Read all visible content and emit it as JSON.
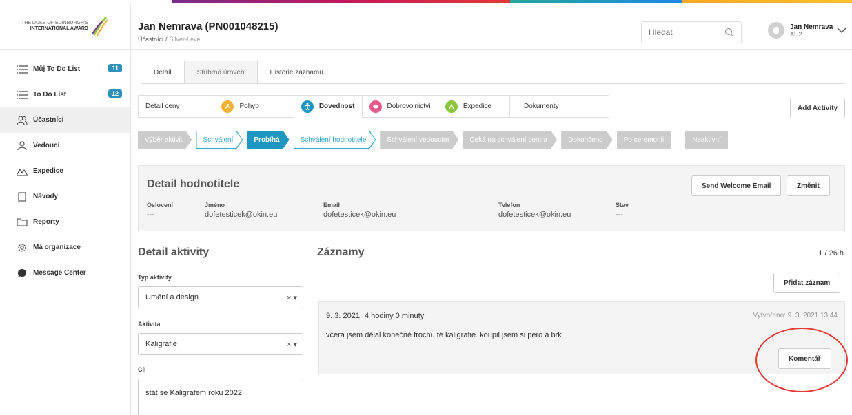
{
  "logo": {
    "line1": "THE DUKE OF EDINBURGH'S",
    "line2": "INTERNATIONAL AWARD"
  },
  "header": {
    "title": "Jan Nemrava (PN001048215)",
    "breadcrumb": [
      "Účastníci",
      "Silver-Level"
    ],
    "breadcrumb_sep": "/",
    "search_placeholder": "Hledat",
    "user_name": "Jan Nemrava",
    "user_role": "AU2"
  },
  "sidebar": {
    "items": [
      {
        "label": "Můj To Do List",
        "badge": "11",
        "icon": "list-icon"
      },
      {
        "label": "To Do List",
        "badge": "12",
        "icon": "list-icon"
      },
      {
        "label": "Účastníci",
        "badge": "",
        "icon": "participants-icon"
      },
      {
        "label": "Vedoucí",
        "badge": "",
        "icon": "leader-icon"
      },
      {
        "label": "Expedice",
        "badge": "",
        "icon": "mountain-icon"
      },
      {
        "label": "Návody",
        "badge": "",
        "icon": "book-icon"
      },
      {
        "label": "Reporty",
        "badge": "",
        "icon": "folder-icon"
      },
      {
        "label": "Má organizace",
        "badge": "",
        "icon": "gear-icon"
      },
      {
        "label": "Message Center",
        "badge": "",
        "icon": "chat-icon"
      }
    ]
  },
  "tabs": {
    "detail": "Detail",
    "silver": "Stříbrná úroveň",
    "history": "Historie záznamu"
  },
  "categories": {
    "detail": "Detail ceny",
    "pohyb": "Pohyb",
    "dovednost": "Dovednost",
    "dobrovolnictvi": "Dobrovolnictví",
    "expedice": "Expedice",
    "dokumenty": "Dokumenty",
    "add_activity": "Add Activity",
    "colors": {
      "pohyb": "#f2b134",
      "dovednost": "#1e96c0",
      "dobrovolnictvi": "#e85a8a",
      "expedice": "#8cc63f"
    }
  },
  "steps": {
    "s1": "Výběr aktivit",
    "s2": "Schválení",
    "s3": "Probíhá",
    "s4": "Schválení hodnotitele",
    "s5": "Schválení vedoucím",
    "s6": "Čeká na schválení centra",
    "s7": "Dokončeno",
    "s8": "Po ceremonii",
    "s9": "Neaktivní"
  },
  "evaluator": {
    "title": "Detail hodnotitele",
    "send_email": "Send Welcome Email",
    "change": "Změnit",
    "salutation_label": "Oslovení",
    "salutation_value": "---",
    "name_label": "Jméno",
    "name_value": "dofetesticek@okin.eu",
    "email_label": "Email",
    "email_value": "dofetesticek@okin.eu",
    "phone_label": "Telefon",
    "phone_value": "dofetesticek@okin.eu",
    "state_label": "Stav",
    "state_value": "---"
  },
  "activity": {
    "title": "Detail aktivity",
    "type_label": "Typ aktivity",
    "type_value": "Umění a design",
    "activity_label": "Aktivita",
    "activity_value": "Kaligrafie",
    "goal_label": "Cíl",
    "goal_value": "stát se Kaligrafem roku 2022",
    "clear_symbol": "×",
    "caret_symbol": "▾"
  },
  "records": {
    "title": "Záznamy",
    "count": "1 / 26 h",
    "add_button": "Přidat záznam",
    "items": [
      {
        "date": "9. 3. 2021",
        "duration": "4 hodiny 0 minuty",
        "created": "Vytvořeno: 9. 3. 2021 13:44",
        "text": "včera jsem dělal konečně trochu té kaligrafie. koupil jsem si pero a brk",
        "comment_button": "Komentář"
      }
    ]
  }
}
